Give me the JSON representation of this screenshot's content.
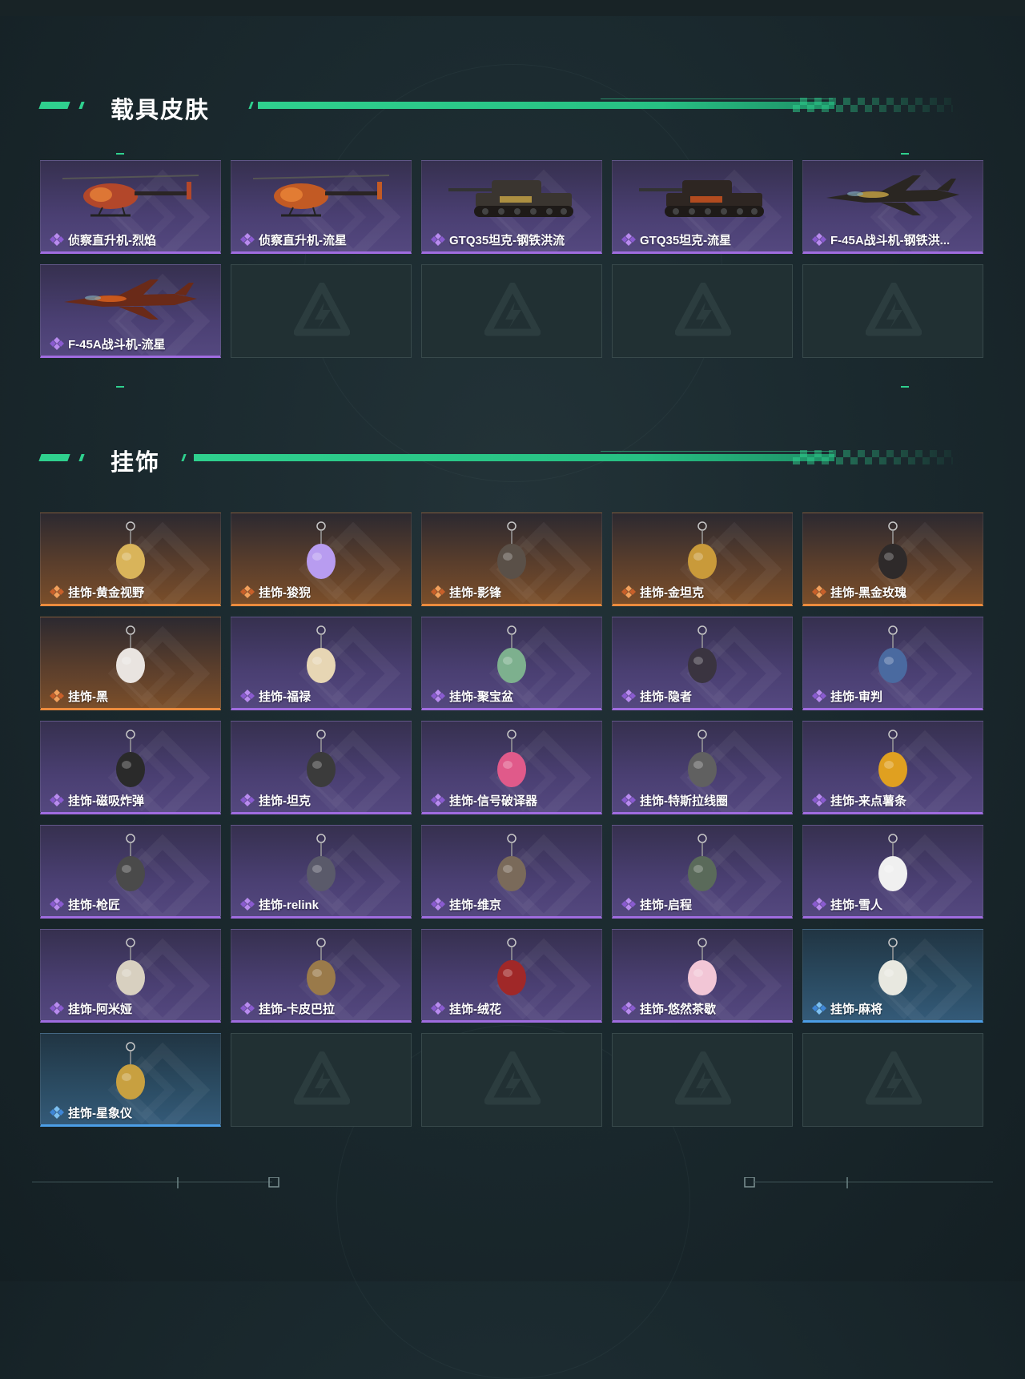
{
  "sections": {
    "vehicle": {
      "title": "载具皮肤",
      "items": [
        {
          "label": "侦察直升机-烈焰",
          "rarity": "purple",
          "icon": "helicopter-icon"
        },
        {
          "label": "侦察直升机-流星",
          "rarity": "purple",
          "icon": "helicopter-icon"
        },
        {
          "label": "GTQ35坦克-钢铁洪流",
          "rarity": "purple",
          "icon": "tank-icon"
        },
        {
          "label": "GTQ35坦克-流星",
          "rarity": "purple",
          "icon": "tank-icon"
        },
        {
          "label": "F-45A战斗机-钢铁洪...",
          "rarity": "purple",
          "icon": "jet-icon"
        },
        {
          "label": "F-45A战斗机-流星",
          "rarity": "purple",
          "icon": "jet-icon"
        }
      ]
    },
    "charms": {
      "title": "挂饰",
      "items": [
        {
          "label": "挂饰-黄金视野",
          "rarity": "orange",
          "icon": "charm-icon"
        },
        {
          "label": "挂饰-狻猊",
          "rarity": "orange",
          "icon": "charm-icon"
        },
        {
          "label": "挂饰-影锋",
          "rarity": "orange",
          "icon": "charm-icon"
        },
        {
          "label": "挂饰-金坦克",
          "rarity": "orange",
          "icon": "charm-icon"
        },
        {
          "label": "挂饰-黑金玫瑰",
          "rarity": "orange",
          "icon": "charm-icon"
        },
        {
          "label": "挂饰-黑",
          "rarity": "orange",
          "icon": "charm-icon"
        },
        {
          "label": "挂饰-福禄",
          "rarity": "purple",
          "icon": "charm-icon"
        },
        {
          "label": "挂饰-聚宝盆",
          "rarity": "purple",
          "icon": "charm-icon"
        },
        {
          "label": "挂饰-隐者",
          "rarity": "purple",
          "icon": "charm-icon"
        },
        {
          "label": "挂饰-审判",
          "rarity": "purple",
          "icon": "charm-icon"
        },
        {
          "label": "挂饰-磁吸炸弹",
          "rarity": "purple",
          "icon": "charm-icon"
        },
        {
          "label": "挂饰-坦克",
          "rarity": "purple",
          "icon": "charm-icon"
        },
        {
          "label": "挂饰-信号破译器",
          "rarity": "purple",
          "icon": "charm-icon"
        },
        {
          "label": "挂饰-特斯拉线圈",
          "rarity": "purple",
          "icon": "charm-icon"
        },
        {
          "label": "挂饰-来点薯条",
          "rarity": "purple",
          "icon": "charm-icon"
        },
        {
          "label": "挂饰-枪匠",
          "rarity": "purple",
          "icon": "charm-icon"
        },
        {
          "label": "挂饰-relink",
          "rarity": "purple",
          "icon": "charm-icon"
        },
        {
          "label": "挂饰-维京",
          "rarity": "purple",
          "icon": "charm-icon"
        },
        {
          "label": "挂饰-启程",
          "rarity": "purple",
          "icon": "charm-icon"
        },
        {
          "label": "挂饰-雪人",
          "rarity": "purple",
          "icon": "charm-icon"
        },
        {
          "label": "挂饰-阿米娅",
          "rarity": "purple",
          "icon": "charm-icon"
        },
        {
          "label": "挂饰-卡皮巴拉",
          "rarity": "purple",
          "icon": "charm-icon"
        },
        {
          "label": "挂饰-绒花",
          "rarity": "purple",
          "icon": "charm-icon"
        },
        {
          "label": "挂饰-悠然茶歇",
          "rarity": "purple",
          "icon": "charm-icon"
        },
        {
          "label": "挂饰-麻将",
          "rarity": "blue",
          "icon": "charm-icon"
        },
        {
          "label": "挂饰-星象仪",
          "rarity": "blue",
          "icon": "charm-icon"
        }
      ]
    }
  },
  "colors": {
    "accent_green": "#2fd08e",
    "rarity_purple": "#a06ce0",
    "rarity_orange": "#ec8b3d",
    "rarity_blue": "#4c9ee6",
    "empty_slot": "#213033"
  }
}
